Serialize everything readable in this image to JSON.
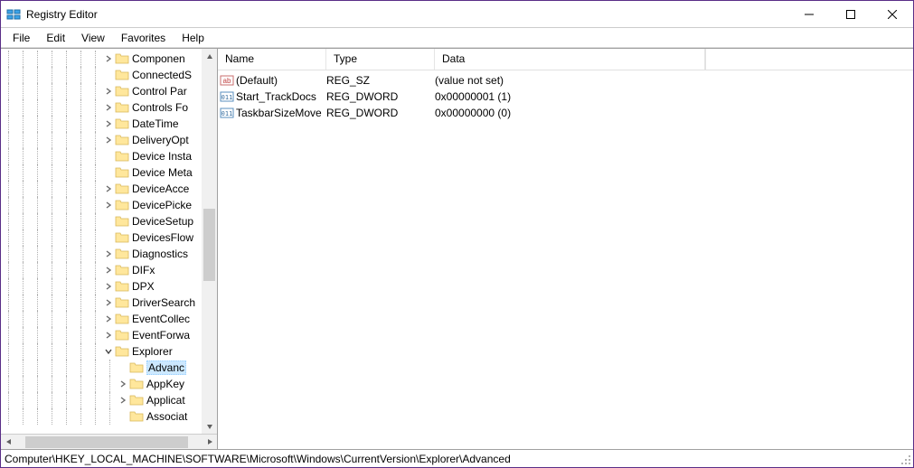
{
  "window": {
    "title": "Registry Editor"
  },
  "menu": {
    "file": "File",
    "edit": "Edit",
    "view": "View",
    "favorites": "Favorites",
    "help": "Help"
  },
  "tree": {
    "items": [
      {
        "label": "Componen",
        "depth": 7,
        "expand": ">",
        "hasExpand": true
      },
      {
        "label": "ConnectedS",
        "depth": 7,
        "expand": "",
        "hasExpand": false
      },
      {
        "label": "Control Par",
        "depth": 7,
        "expand": ">",
        "hasExpand": true
      },
      {
        "label": "Controls Fo",
        "depth": 7,
        "expand": ">",
        "hasExpand": true
      },
      {
        "label": "DateTime",
        "depth": 7,
        "expand": ">",
        "hasExpand": true
      },
      {
        "label": "DeliveryOpt",
        "depth": 7,
        "expand": ">",
        "hasExpand": true
      },
      {
        "label": "Device Insta",
        "depth": 7,
        "expand": "",
        "hasExpand": false
      },
      {
        "label": "Device Meta",
        "depth": 7,
        "expand": "",
        "hasExpand": false
      },
      {
        "label": "DeviceAcce",
        "depth": 7,
        "expand": ">",
        "hasExpand": true
      },
      {
        "label": "DevicePicke",
        "depth": 7,
        "expand": ">",
        "hasExpand": true
      },
      {
        "label": "DeviceSetup",
        "depth": 7,
        "expand": "",
        "hasExpand": false
      },
      {
        "label": "DevicesFlow",
        "depth": 7,
        "expand": "",
        "hasExpand": false
      },
      {
        "label": "Diagnostics",
        "depth": 7,
        "expand": ">",
        "hasExpand": true
      },
      {
        "label": "DIFx",
        "depth": 7,
        "expand": ">",
        "hasExpand": true
      },
      {
        "label": "DPX",
        "depth": 7,
        "expand": ">",
        "hasExpand": true
      },
      {
        "label": "DriverSearch",
        "depth": 7,
        "expand": ">",
        "hasExpand": true
      },
      {
        "label": "EventCollec",
        "depth": 7,
        "expand": ">",
        "hasExpand": true
      },
      {
        "label": "EventForwa",
        "depth": 7,
        "expand": ">",
        "hasExpand": true
      },
      {
        "label": "Explorer",
        "depth": 7,
        "expand": "v",
        "hasExpand": true,
        "open": true
      },
      {
        "label": "Advanc",
        "depth": 8,
        "expand": "",
        "hasExpand": false,
        "selected": true
      },
      {
        "label": "AppKey",
        "depth": 8,
        "expand": ">",
        "hasExpand": true
      },
      {
        "label": "Applicat",
        "depth": 8,
        "expand": ">",
        "hasExpand": true
      },
      {
        "label": "Associat",
        "depth": 8,
        "expand": "",
        "hasExpand": false
      }
    ]
  },
  "list": {
    "columns": {
      "name": "Name",
      "type": "Type",
      "data": "Data"
    },
    "rows": [
      {
        "icon": "string",
        "name": "(Default)",
        "type": "REG_SZ",
        "data": "(value not set)"
      },
      {
        "icon": "binary",
        "name": "Start_TrackDocs",
        "type": "REG_DWORD",
        "data": "0x00000001 (1)"
      },
      {
        "icon": "binary",
        "name": "TaskbarSizeMove",
        "type": "REG_DWORD",
        "data": "0x00000000 (0)"
      }
    ]
  },
  "statusbar": {
    "path": "Computer\\HKEY_LOCAL_MACHINE\\SOFTWARE\\Microsoft\\Windows\\CurrentVersion\\Explorer\\Advanced"
  }
}
